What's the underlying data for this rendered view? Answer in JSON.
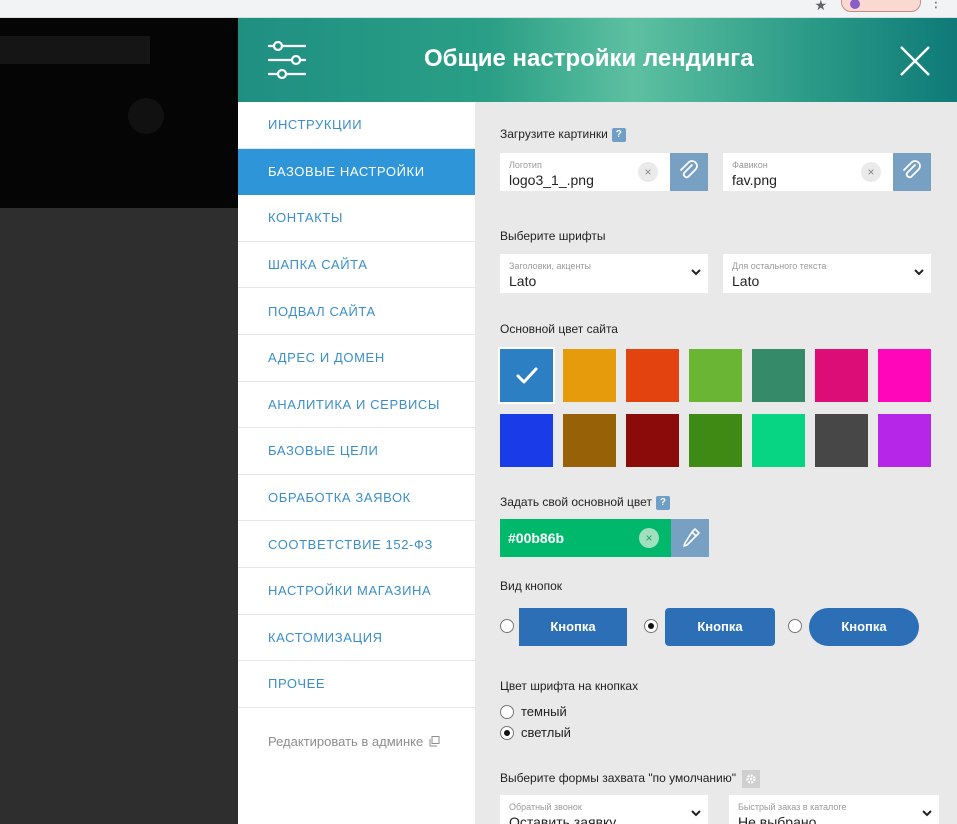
{
  "header": {
    "title": "Общие настройки лендинга"
  },
  "sidebar": {
    "items": [
      {
        "label": "ИНСТРУКЦИИ"
      },
      {
        "label": "БАЗОВЫЕ НАСТРОЙКИ"
      },
      {
        "label": "КОНТАКТЫ"
      },
      {
        "label": "ШАПКА САЙТА"
      },
      {
        "label": "ПОДВАЛ САЙТА"
      },
      {
        "label": "АДРЕС И ДОМЕН"
      },
      {
        "label": "АНАЛИТИКА И СЕРВИСЫ"
      },
      {
        "label": "БАЗОВЫЕ ЦЕЛИ"
      },
      {
        "label": "ОБРАБОТКА ЗАЯВОК"
      },
      {
        "label": "СООТВЕТСТВИЕ 152-ФЗ"
      },
      {
        "label": "НАСТРОЙКИ МАГАЗИНА"
      },
      {
        "label": "КАСТОМИЗАЦИЯ"
      },
      {
        "label": "ПРОЧЕЕ"
      }
    ],
    "active_index": 1,
    "admin_link": "Редактировать в админке"
  },
  "images": {
    "label": "Загрузите картинки",
    "help": "?",
    "logo": {
      "sub": "Логотип",
      "value": "logo3_1_.png"
    },
    "favicon": {
      "sub": "Фавикон",
      "value": "fav.png"
    },
    "clear": "×"
  },
  "fonts": {
    "label": "Выберите шрифты",
    "headings": {
      "sub": "Заголовки, акценты",
      "value": "Lato"
    },
    "body": {
      "sub": "Для остального текста",
      "value": "Lato"
    }
  },
  "main_color": {
    "label": "Основной цвет сайта",
    "swatches": [
      "#2c7fc2",
      "#e59b0b",
      "#e2430f",
      "#6ab534",
      "#358a69",
      "#dd0d78",
      "#ff06bb",
      "#1a3be8",
      "#966107",
      "#8b0a0a",
      "#3f8a14",
      "#07d583",
      "#474747",
      "#b626e8"
    ],
    "selected_index": 0
  },
  "custom_color": {
    "label": "Задать свой основной цвет",
    "help": "?",
    "value": "#00b86b",
    "bg": "#00b86b"
  },
  "button_style": {
    "label": "Вид кнопок",
    "options": [
      {
        "label": "Кнопка",
        "shape": "square",
        "checked": false
      },
      {
        "label": "Кнопка",
        "shape": "rounded",
        "checked": true
      },
      {
        "label": "Кнопка",
        "shape": "pill",
        "checked": false
      }
    ]
  },
  "button_font_color": {
    "label": "Цвет шрифта на кнопках",
    "options": [
      {
        "label": "темный",
        "checked": false
      },
      {
        "label": "светлый",
        "checked": true
      }
    ]
  },
  "capture_forms": {
    "label": "Выберите формы захвата \"по умолчанию\"",
    "callback": {
      "sub": "Обратный звонок",
      "value": "Оставить заявку"
    },
    "quick_order": {
      "sub": "Быстрый заказ в каталоге",
      "value": "Не выбрано"
    }
  },
  "colors": {
    "accent": "#2d95d8",
    "nav_text": "#3a8fc9",
    "button_blue": "#2c6fb6",
    "attach_btn": "#77a0c2"
  }
}
